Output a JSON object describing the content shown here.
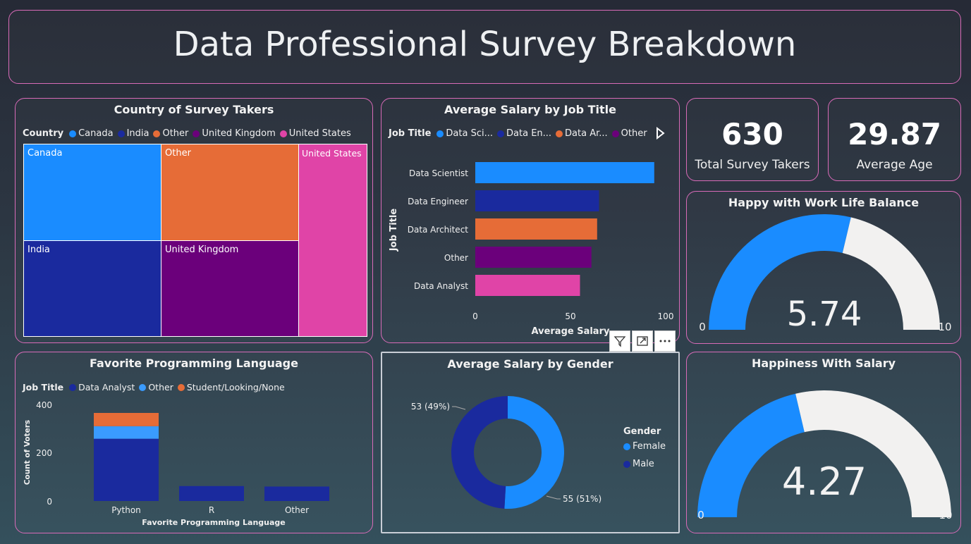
{
  "header": {
    "title": "Data Professional Survey Breakdown"
  },
  "colors": {
    "accent_border": "#d86bb8",
    "light_blue": "#1a8cff",
    "dark_blue": "#1a2a9e",
    "orange": "#e66c37",
    "purple": "#6b007b",
    "pink": "#e044a7",
    "gauge_bg": "#f2f1f0"
  },
  "treemap": {
    "title": "Country of Survey Takers",
    "legend_title": "Country",
    "legend": [
      {
        "label": "Canada",
        "color": "#1a8cff"
      },
      {
        "label": "India",
        "color": "#1a2a9e"
      },
      {
        "label": "Other",
        "color": "#e66c37"
      },
      {
        "label": "United Kingdom",
        "color": "#6b007b"
      },
      {
        "label": "United States",
        "color": "#e044a7"
      }
    ],
    "cells": [
      {
        "label": "Canada"
      },
      {
        "label": "Other"
      },
      {
        "label": "United States"
      },
      {
        "label": "India"
      },
      {
        "label": "United Kingdom"
      }
    ]
  },
  "salary_by_job": {
    "title": "Average Salary by Job Title",
    "legend_title": "Job Title",
    "legend": [
      {
        "label": "Data Sci...",
        "color": "#1a8cff"
      },
      {
        "label": "Data En...",
        "color": "#1a2a9e"
      },
      {
        "label": "Data Ar...",
        "color": "#e66c37"
      },
      {
        "label": "Other",
        "color": "#6b007b"
      }
    ],
    "ylabel": "Job Title",
    "xlabel": "Average Salary",
    "ticks": [
      "0",
      "50",
      "100"
    ]
  },
  "kpis": [
    {
      "value": "630",
      "label": "Total Survey Takers"
    },
    {
      "value": "29.87",
      "label": "Average Age"
    }
  ],
  "gauge_work_life": {
    "title": "Happy with Work Life Balance",
    "value": 5.74,
    "value_text": "5.74",
    "min": "0",
    "max": "10"
  },
  "gauge_salary": {
    "title": "Happiness With Salary",
    "value": 4.27,
    "value_text": "4.27",
    "min": "0",
    "max": "10"
  },
  "languages": {
    "title": "Favorite Programming Language",
    "legend_title": "Job Title",
    "legend": [
      {
        "label": "Data Analyst",
        "color": "#1a2a9e"
      },
      {
        "label": "Other",
        "color": "#3a9bff"
      },
      {
        "label": "Student/Looking/None",
        "color": "#e66c37"
      }
    ],
    "ylabel": "Count of Voters",
    "xlabel": "Favorite Programming Language",
    "yticks": [
      "400",
      "200",
      "0"
    ]
  },
  "gender": {
    "title": "Average Salary by Gender",
    "legend_title": "Gender",
    "legend": [
      {
        "label": "Female",
        "color": "#1a8cff"
      },
      {
        "label": "Male",
        "color": "#1a2a9e"
      }
    ]
  },
  "chart_data": [
    {
      "type": "bar",
      "title": "Average Salary by Job Title",
      "categories": [
        "Data Scientist",
        "Data Engineer",
        "Data Architect",
        "Other",
        "Data Analyst"
      ],
      "values": [
        94,
        65,
        64,
        61,
        55
      ],
      "colors": [
        "#1a8cff",
        "#1a2a9e",
        "#e66c37",
        "#6b007b",
        "#e044a7"
      ],
      "xlabel": "Average Salary",
      "ylabel": "Job Title",
      "xlim": [
        0,
        100
      ],
      "orientation": "horizontal"
    },
    {
      "type": "bar",
      "title": "Favorite Programming Language",
      "categories": [
        "Python",
        "R",
        "Other"
      ],
      "series": [
        {
          "name": "Data Analyst",
          "values": [
            258,
            62,
            60
          ]
        },
        {
          "name": "Other",
          "values": [
            52,
            0,
            0
          ]
        },
        {
          "name": "Student/Looking/None",
          "values": [
            55,
            0,
            0
          ]
        }
      ],
      "xlabel": "Favorite Programming Language",
      "ylabel": "Count of Voters",
      "ylim": [
        0,
        400
      ],
      "stacked": true
    },
    {
      "type": "pie",
      "title": "Average Salary by Gender",
      "categories": [
        "Female",
        "Male"
      ],
      "values": [
        55,
        53
      ],
      "labels": [
        "55 (51%)",
        "53 (49%)"
      ],
      "donut": true
    }
  ]
}
